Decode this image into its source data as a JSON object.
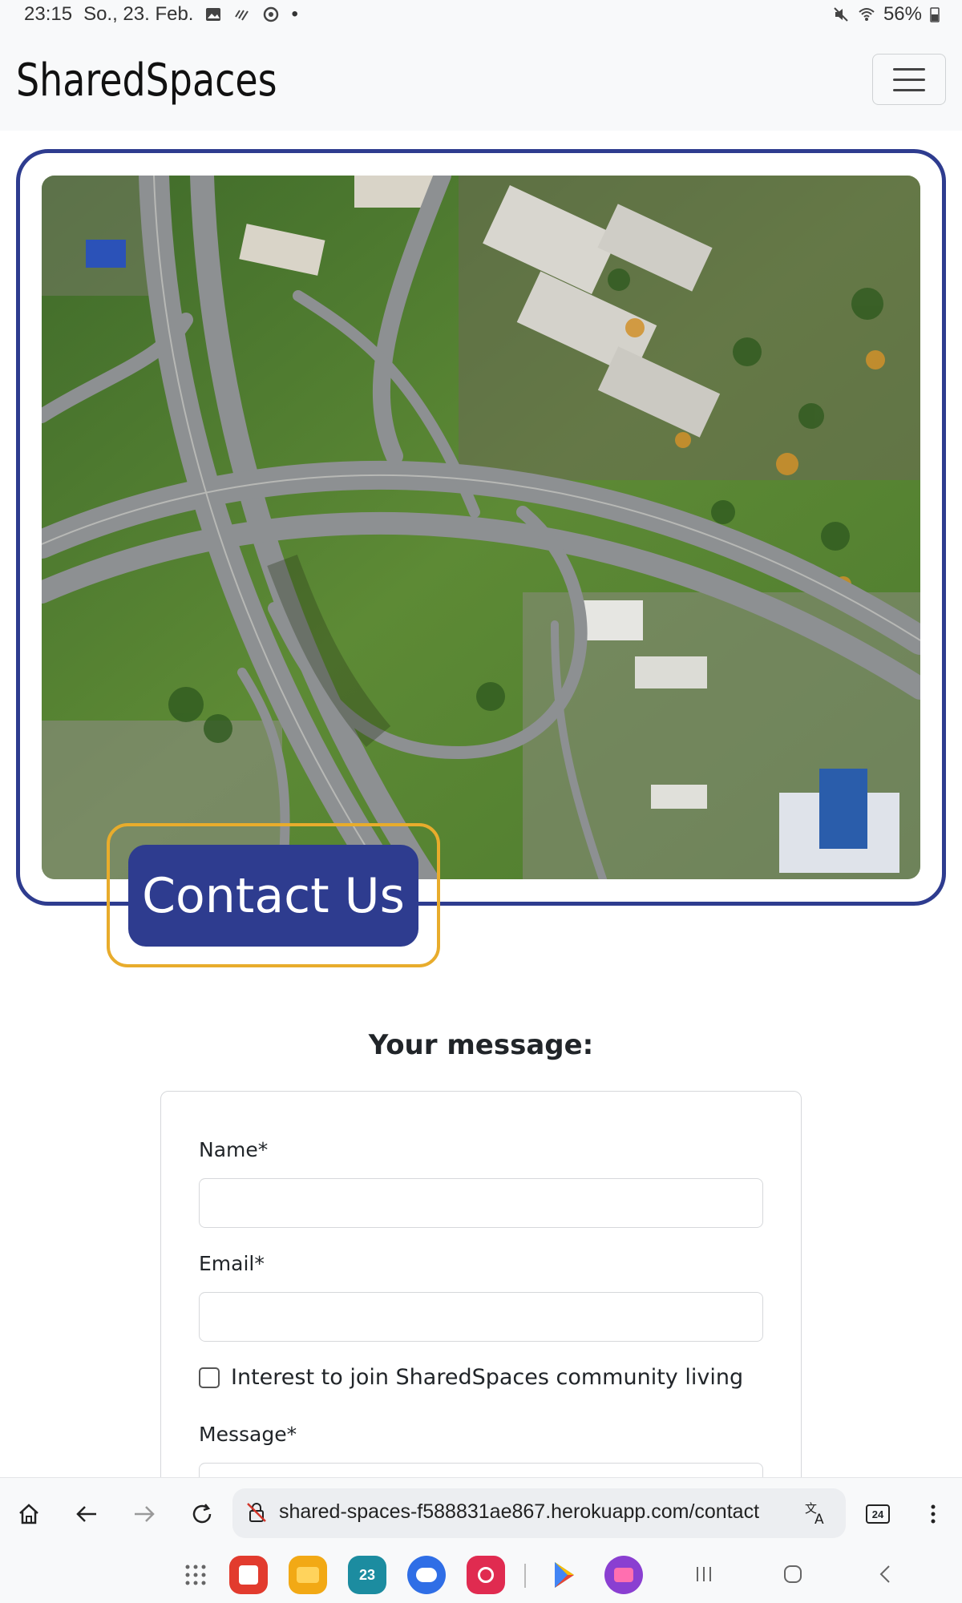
{
  "status_bar": {
    "time": "23:15",
    "date": "So., 23. Feb.",
    "battery": "56%"
  },
  "navbar": {
    "brand": "SharedSpaces",
    "menu_icon": "hamburger-menu-icon"
  },
  "hero": {
    "image_alt": "aerial-highway-interchange",
    "cta_label": "Contact Us"
  },
  "form": {
    "heading": "Your message:",
    "name_label": "Name*",
    "name_value": "",
    "email_label": "Email*",
    "email_value": "",
    "interest_label": "Interest to join SharedSpaces community living",
    "interest_checked": false,
    "message_label": "Message*"
  },
  "browser": {
    "url": "shared-spaces-f588831ae867.herokuapp.com/contact",
    "tabs_count": "24"
  },
  "dock": {
    "calendar_day": "23"
  },
  "colors": {
    "primary": "#2e3c8f",
    "accent": "#e8ac2c",
    "navbar_bg": "#f8f9fa"
  }
}
